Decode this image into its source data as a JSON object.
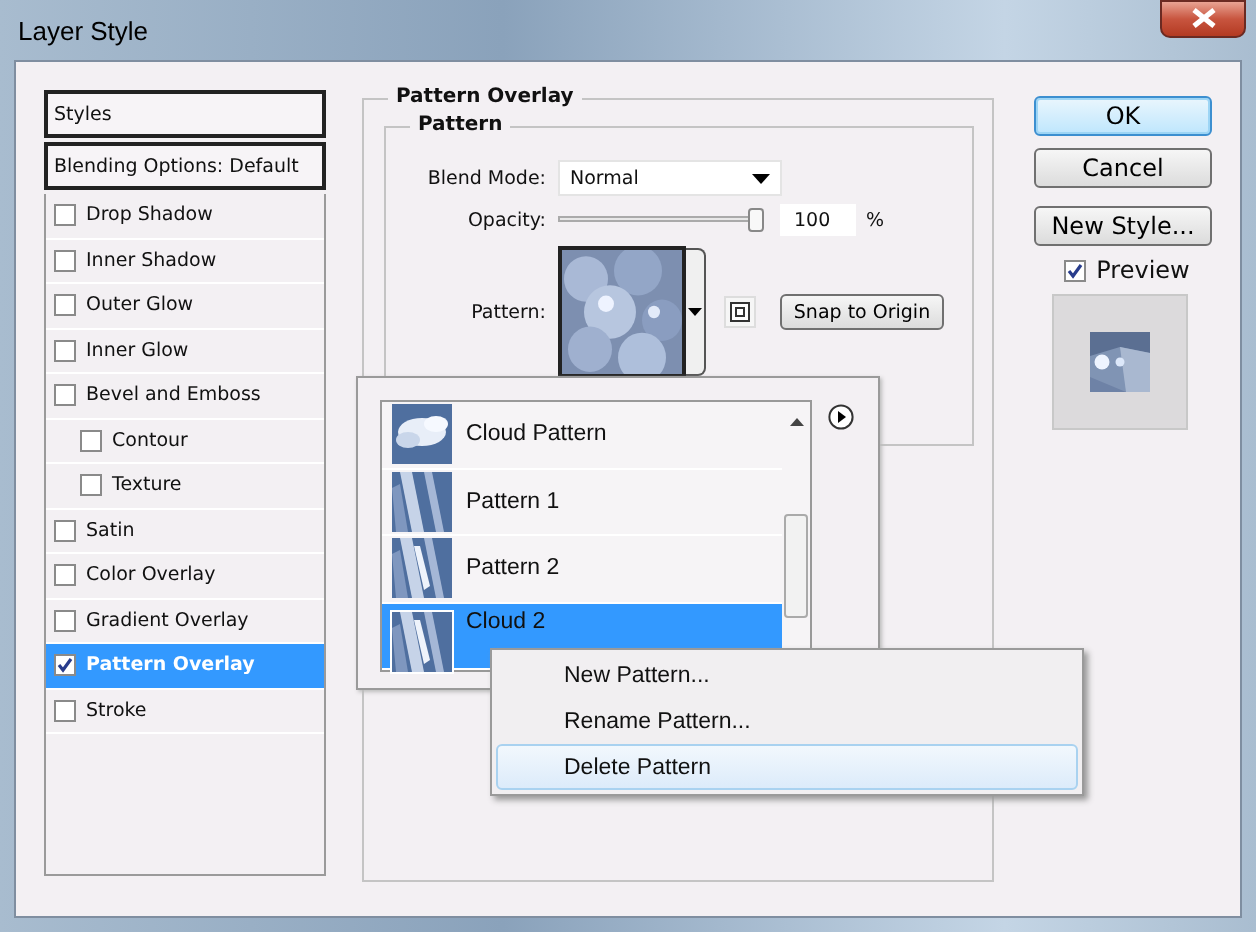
{
  "window": {
    "title": "Layer Style"
  },
  "styles_list": {
    "header": "Styles",
    "default_item": {
      "label": "Blending Options: Default",
      "selected": false
    },
    "items": [
      {
        "label": "Drop Shadow",
        "checked": false,
        "selected": false
      },
      {
        "label": "Inner Shadow",
        "checked": false,
        "selected": false
      },
      {
        "label": "Outer Glow",
        "checked": false,
        "selected": false
      },
      {
        "label": "Inner Glow",
        "checked": false,
        "selected": false
      },
      {
        "label": "Bevel and Emboss",
        "checked": false,
        "selected": false,
        "children": [
          {
            "label": "Contour",
            "checked": false,
            "selected": false
          },
          {
            "label": "Texture",
            "checked": false,
            "selected": false
          }
        ]
      },
      {
        "label": "Satin",
        "checked": false,
        "selected": false
      },
      {
        "label": "Color Overlay",
        "checked": false,
        "selected": false
      },
      {
        "label": "Gradient Overlay",
        "checked": false,
        "selected": false
      },
      {
        "label": "Pattern Overlay",
        "checked": true,
        "selected": true
      },
      {
        "label": "Stroke",
        "checked": false,
        "selected": false
      }
    ]
  },
  "pattern_overlay": {
    "title": "Pattern Overlay",
    "group_title": "Pattern",
    "blend_mode_label": "Blend Mode:",
    "blend_mode": "Normal",
    "opacity_label": "Opacity:",
    "opacity": {
      "level": 0.97
    },
    "opacity_value": "100",
    "opacity_unit": "%",
    "pattern_label": "Pattern:",
    "snap_button": "Snap to Origin"
  },
  "pattern_picker": {
    "items": [
      {
        "label": "Cloud Pattern",
        "selected": false
      },
      {
        "label": "Pattern 1",
        "selected": false
      },
      {
        "label": "Pattern 2",
        "selected": false
      },
      {
        "label": "Cloud 2",
        "selected": true
      }
    ]
  },
  "context_menu": {
    "items": [
      {
        "label": "New Pattern...",
        "selected": false
      },
      {
        "label": "Rename Pattern...",
        "selected": false
      },
      {
        "label": "Delete Pattern",
        "selected": true
      }
    ]
  },
  "buttons": [
    {
      "label": "OK",
      "default": true
    },
    {
      "label": "Cancel",
      "default": false
    },
    {
      "label": "New Style...",
      "default": false
    }
  ],
  "preview": {
    "label": "Preview",
    "checked": true
  }
}
